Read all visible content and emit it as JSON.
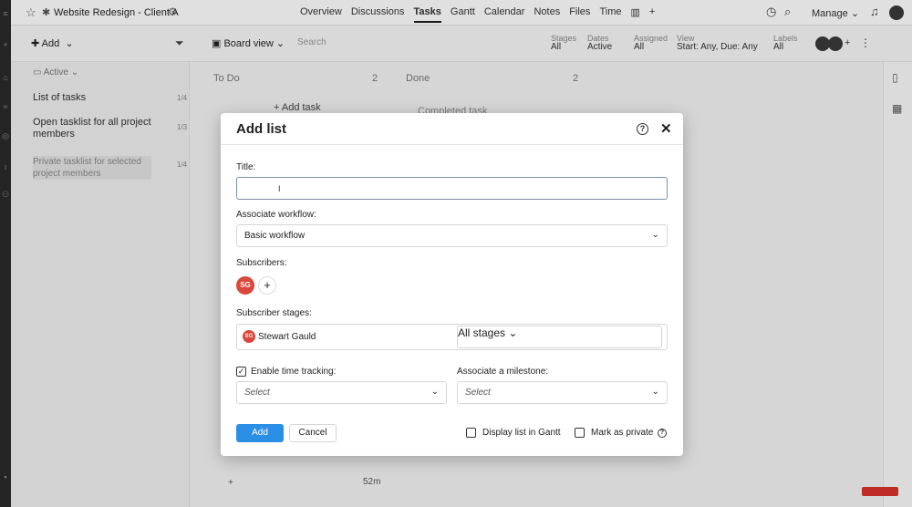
{
  "topbar": {
    "project_title": "Website Redesign - Client A",
    "nav": [
      "Overview",
      "Discussions",
      "Tasks",
      "Gantt",
      "Calendar",
      "Notes",
      "Files",
      "Time"
    ],
    "active_nav": "Tasks",
    "manage_label": "Manage"
  },
  "toolbar": {
    "add_label": "Add",
    "board_view_label": "Board view",
    "search_placeholder": "Search",
    "filters": [
      {
        "label": "Stages",
        "value": "All"
      },
      {
        "label": "Dates",
        "value": "Active"
      },
      {
        "label": "Assigned",
        "value": "All"
      },
      {
        "label": "View",
        "value": "Start: Any, Due: Any"
      },
      {
        "label": "Labels",
        "value": "All"
      }
    ]
  },
  "sidebar": {
    "filter_label": "Active",
    "items": [
      {
        "label": "List of tasks",
        "count": "1/4"
      },
      {
        "label": "Open tasklist for all project members",
        "count": "1/3"
      },
      {
        "label": "Private tasklist for selected project members",
        "count": "1/4"
      }
    ]
  },
  "board": {
    "col1_title": "To Do",
    "col1_count": "2",
    "col2_title": "Done",
    "col2_count": "2",
    "add_task_label": "Add task",
    "done_item": "Completed task",
    "bottom_time": "52m"
  },
  "modal": {
    "title": "Add list",
    "title_label": "Title:",
    "title_value": "",
    "workflow_label": "Associate workflow:",
    "workflow_value": "Basic workflow",
    "subscribers_label": "Subscribers:",
    "subscriber_initials": "SG",
    "stages_label": "Subscriber stages:",
    "stage_user": "Stewart Gauld",
    "stage_value": "All stages",
    "time_tracking_label": "Enable time tracking:",
    "time_tracking_value": "Select",
    "milestone_label": "Associate a milestone:",
    "milestone_value": "Select",
    "add_button": "Add",
    "cancel_button": "Cancel",
    "gantt_label": "Display list in Gantt",
    "private_label": "Mark as private"
  },
  "colors": {
    "primary": "#2c8fe6",
    "avatar": "#d9483b",
    "rail": "#2b2b2b"
  }
}
